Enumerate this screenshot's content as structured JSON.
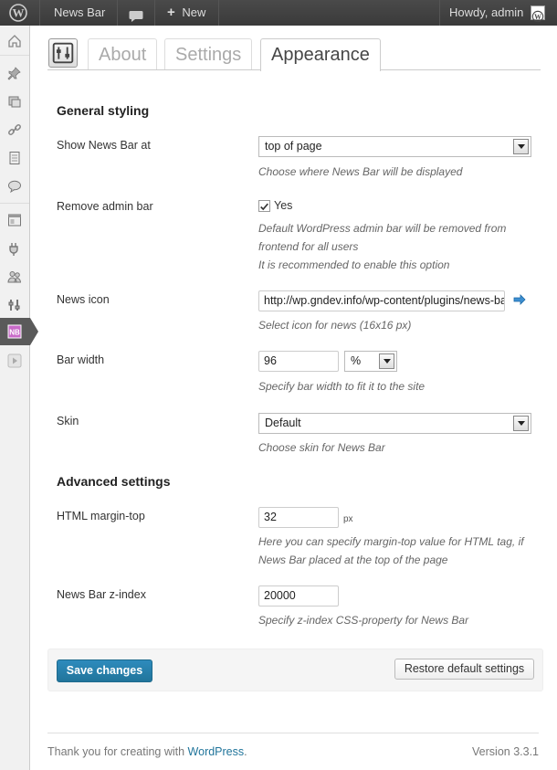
{
  "adminbar": {
    "site_name": "News Bar",
    "new_label": "New",
    "greeting": "Howdy, admin"
  },
  "tabs": [
    {
      "label": "About"
    },
    {
      "label": "Settings"
    },
    {
      "label": "Appearance"
    }
  ],
  "active_tab": "Appearance",
  "general": {
    "title": "General styling",
    "show_at": {
      "label": "Show News Bar at",
      "value": "top of page",
      "desc": "Choose where News Bar will be displayed"
    },
    "remove_admin_bar": {
      "label": "Remove admin bar",
      "checked": true,
      "checkbox_label": "Yes",
      "desc1": "Default WordPress admin bar will be removed from",
      "desc2": "frontend for all users",
      "desc3": "It is recommended to enable this option"
    },
    "news_icon": {
      "label": "News icon",
      "value": "http://wp.gndev.info/wp-content/plugins/news-ba",
      "desc": "Select icon for news (16x16 px)"
    },
    "bar_width": {
      "label": "Bar width",
      "value": "96",
      "unit": "%",
      "desc": "Specify bar width to fit it to the site"
    },
    "skin": {
      "label": "Skin",
      "value": "Default",
      "desc": "Choose skin for News Bar"
    }
  },
  "advanced": {
    "title": "Advanced settings",
    "margin_top": {
      "label": "HTML margin-top",
      "value": "32",
      "unit": "px",
      "desc1": "Here you can specify margin-top value for HTML tag, if",
      "desc2": "News Bar placed at the top of the page"
    },
    "z_index": {
      "label": "News Bar z-index",
      "value": "20000",
      "desc": "Specify z-index CSS-property for News Bar"
    }
  },
  "buttons": {
    "save": "Save changes",
    "restore": "Restore default settings"
  },
  "footer": {
    "thanks_prefix": "Thank you for creating with ",
    "wordpress_link": "WordPress",
    "thanks_suffix": ".",
    "version": "Version 3.3.1"
  },
  "colors": {
    "adminbar_bg": "#464646",
    "accent": "#21759b",
    "sidebar_bg": "#f1f1f1"
  }
}
